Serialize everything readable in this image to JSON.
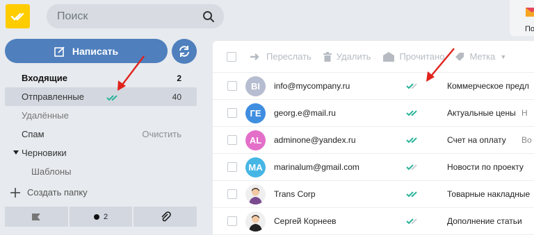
{
  "search": {
    "placeholder": "Поиск"
  },
  "promo": {
    "label": "По"
  },
  "compose": {
    "label": "Написать"
  },
  "folders": [
    {
      "label": "Входящие",
      "count": "2",
      "style": "bold"
    },
    {
      "label": "Отправленные",
      "count": "40",
      "style": "active"
    },
    {
      "label": "Удалённые",
      "count": "",
      "style": "muted"
    },
    {
      "label": "Спам",
      "count": "",
      "action": "Очистить",
      "style": ""
    },
    {
      "label": "Черновики",
      "count": "",
      "style": "expand"
    },
    {
      "label": "Шаблоны",
      "count": "",
      "style": "sub"
    }
  ],
  "new_folder": {
    "label": "Создать папку"
  },
  "bottom_bar": {
    "unread_count": "2"
  },
  "toolbar": {
    "forward": "Переслать",
    "delete": "Удалить",
    "read": "Прочитано",
    "label": "Метка"
  },
  "messages": [
    {
      "initials": "BI",
      "avatar_color": "#b7bdd0",
      "sender": "info@mycompany.ru",
      "status": "partial",
      "subject": "Коммерческое предл",
      "snippet": ""
    },
    {
      "initials": "ГЕ",
      "avatar_color": "#3f8ee0",
      "sender": "georg.e@mail.ru",
      "status": "read",
      "subject": "Актуальные цены",
      "snippet": "Н"
    },
    {
      "initials": "AL",
      "avatar_color": "#e36fc9",
      "sender": "adminone@yandex.ru",
      "status": "read",
      "subject": "Счет на оплату",
      "snippet": "Во"
    },
    {
      "initials": "MA",
      "avatar_color": "#46b6e5",
      "sender": "marinalum@gmail.com",
      "status": "partial",
      "subject": "Новости по проекту",
      "snippet": ""
    },
    {
      "initials": "",
      "avatar_color": "#efefef",
      "avatar_icon": "person-photo-icon",
      "sender": "Trans Corp",
      "status": "read",
      "subject": "Товарные накладные",
      "snippet": ""
    },
    {
      "initials": "",
      "avatar_color": "#efefef",
      "avatar_icon": "person-photo-icon",
      "sender": "Сергей Корнеев",
      "status": "partial",
      "subject": "Дополнение статьи",
      "snippet": ""
    }
  ],
  "colors": {
    "accent": "#4f7fbd",
    "logo": "#ffcc00",
    "check_read": "#2bb39a",
    "annotation_arrow": "#e0231c"
  }
}
